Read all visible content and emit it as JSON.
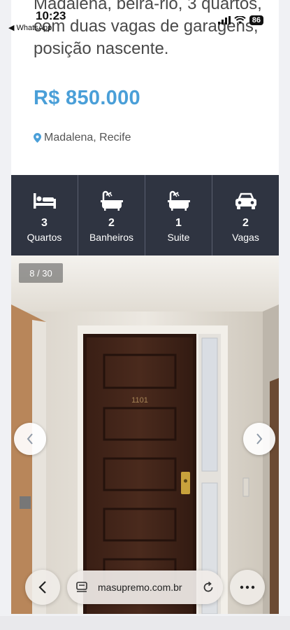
{
  "status_bar": {
    "time": "10:23",
    "back_app": "◀ WhatsApp",
    "battery": "86"
  },
  "listing": {
    "title": "Madalena, beira-rio, 3 quartos, com duas vagas de garagens, posição nascente.",
    "price": "R$ 850.000",
    "location": "Madalena, Recife"
  },
  "features": [
    {
      "value": "3",
      "label": "Quartos",
      "icon": "bed-icon"
    },
    {
      "value": "2",
      "label": "Banheiros",
      "icon": "bathtub-icon"
    },
    {
      "value": "1",
      "label": "Suite",
      "icon": "bathtub-icon"
    },
    {
      "value": "2",
      "label": "Vagas",
      "icon": "car-icon"
    }
  ],
  "gallery": {
    "counter": "8 / 30",
    "door_number": "1101"
  },
  "browser": {
    "url": "masupremo.com.br"
  },
  "colors": {
    "price": "#4a9fd8",
    "feature_bar": "#2f3441"
  }
}
